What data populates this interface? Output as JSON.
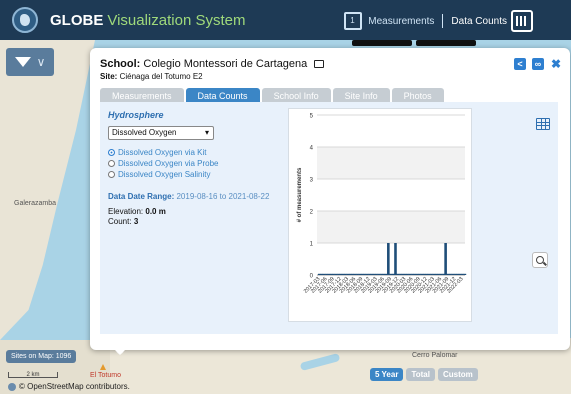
{
  "header": {
    "logo_icon": "globe-logo-icon",
    "brand": "GLOBE",
    "app_name": "Visualization System",
    "measurements_label": "Measurements",
    "data_counts_label": "Data Counts"
  },
  "map": {
    "labels": {
      "galerazamba": "Galerazamba",
      "el_totumo": "El Totumo",
      "cerro_palomar": "Cerro Palomar"
    },
    "sites_on_map": "Sites on Map: 1096",
    "scale": "2 km",
    "attribution": "© OpenStreetMap contributors."
  },
  "modal": {
    "school_prefix": "School:",
    "school_name": "Colegio Montessori de Cartagena",
    "site_prefix": "Site:",
    "site_name": "Ciénaga del Totumo E2",
    "tabs": [
      "Measurements",
      "Data Counts",
      "School Info",
      "Site Info",
      "Photos"
    ],
    "active_tab": "Data Counts",
    "sphere": "Hydrosphere",
    "selected_measure": "Dissolved Oxygen",
    "radios": [
      {
        "label": "Dissolved Oxygen via Kit",
        "checked": true
      },
      {
        "label": "Dissolved Oxygen via Probe",
        "checked": false
      },
      {
        "label": "Dissolved Oxygen Salinity",
        "checked": false
      }
    ],
    "date_range_label": "Data Date Range:",
    "date_range_value": "2019-08-16 to 2021-08-22",
    "elevation_label": "Elevation:",
    "elevation_value": "0.0 m",
    "count_label": "Count:",
    "count_value": "3",
    "range_buttons": [
      "5 Year",
      "Total",
      "Custom"
    ],
    "active_range": "5 Year"
  },
  "chart_data": {
    "type": "bar",
    "ylabel": "# of measurements",
    "ylim": [
      0,
      5
    ],
    "yticks": [
      0,
      1,
      2,
      3,
      4,
      5
    ],
    "categories": [
      "2017-03",
      "2017-06",
      "2017-09",
      "2017-12",
      "2018-03",
      "2018-06",
      "2018-09",
      "2018-12",
      "2019-03",
      "2019-06",
      "2019-09",
      "2019-12",
      "2020-03",
      "2020-06",
      "2020-09",
      "2020-12",
      "2021-03",
      "2021-06",
      "2021-09",
      "2021-12",
      "2022-03"
    ],
    "bars": [
      {
        "x": "2019-08",
        "value": 1
      },
      {
        "x": "2019-11",
        "value": 1
      },
      {
        "x": "2021-08",
        "value": 1
      }
    ],
    "bar_color": "#1f4e79"
  }
}
